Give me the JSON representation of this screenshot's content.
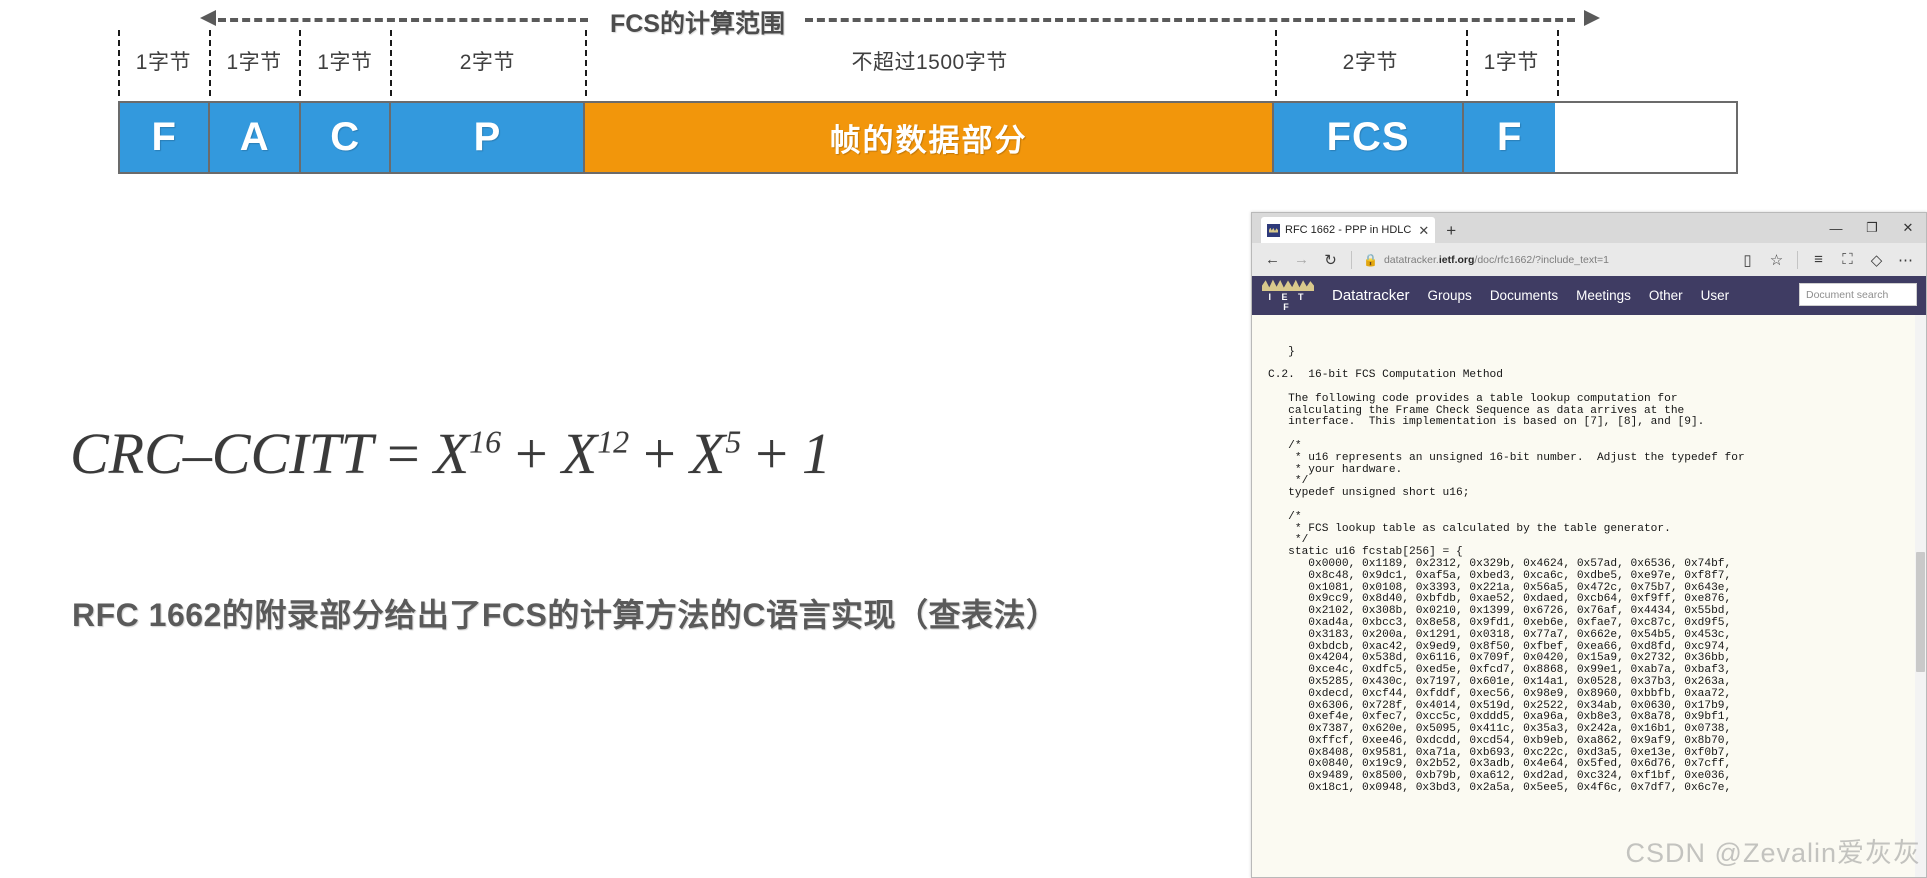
{
  "frame_diagram": {
    "scope_label": "FCS的计算范围",
    "fields": [
      {
        "size_label": "1字节",
        "name": "F",
        "color": "#3399dd",
        "width_pct": 5.6,
        "cjk": false
      },
      {
        "size_label": "1字节",
        "name": "A",
        "color": "#3399dd",
        "width_pct": 5.6,
        "cjk": false
      },
      {
        "size_label": "1字节",
        "name": "C",
        "color": "#3399dd",
        "width_pct": 5.6,
        "cjk": false
      },
      {
        "size_label": "2字节",
        "name": "P",
        "color": "#3399dd",
        "width_pct": 12.0,
        "cjk": false
      },
      {
        "size_label": "不超过1500字节",
        "name": "帧的数据部分",
        "color": "#f2960b",
        "width_pct": 42.6,
        "cjk": true
      },
      {
        "size_label": "2字节",
        "name": "FCS",
        "color": "#3399dd",
        "width_pct": 11.8,
        "cjk": false
      },
      {
        "size_label": "1字节",
        "name": "F",
        "color": "#3399dd",
        "width_pct": 5.6,
        "cjk": false
      }
    ],
    "colors": {
      "blue": "#3399dd",
      "orange": "#f2960b",
      "border": "#6b6b6b",
      "dash": "#1a1a1a"
    }
  },
  "formula": {
    "lhs": "CRC–CCITT",
    "equals": "=",
    "terms": [
      {
        "base": "X",
        "exp": "16"
      },
      {
        "base": "X",
        "exp": "12"
      },
      {
        "base": "X",
        "exp": "5"
      },
      {
        "base": "1",
        "exp": ""
      }
    ],
    "plus": "+"
  },
  "caption": "RFC 1662的附录部分给出了FCS的计算方法的C语言实现（查表法）",
  "browser": {
    "tab": {
      "title": "RFC 1662 - PPP in HDLC",
      "close": "✕"
    },
    "new_tab": "+",
    "window_controls": {
      "minimize": "—",
      "maximize": "❐",
      "close": "✕"
    },
    "toolbar": {
      "back": "←",
      "forward": "→",
      "refresh": "↻",
      "lock": "🔒",
      "url_prefix": "datatracker.",
      "url_bold": "ietf.org",
      "url_suffix": "/doc/rfc1662/?include_text=1",
      "reading_view": "▯",
      "favorite": "☆",
      "reading_list": "≡",
      "collections": "⛶",
      "share": "◇",
      "more": "⋯"
    },
    "ietf_nav": {
      "logo_letters": "I E T F",
      "items": [
        "Datatracker",
        "Groups",
        "Documents",
        "Meetings",
        "Other",
        "User"
      ],
      "search_placeholder": "Document search",
      "bar_color": "#3f3c63"
    },
    "document": {
      "lines": [
        "   }",
        "",
        "C.2.  16-bit FCS Computation Method",
        "",
        "   The following code provides a table lookup computation for",
        "   calculating the Frame Check Sequence as data arrives at the",
        "   interface.  This implementation is based on [7], [8], and [9].",
        "",
        "   /*",
        "    * u16 represents an unsigned 16-bit number.  Adjust the typedef for",
        "    * your hardware.",
        "    */",
        "   typedef unsigned short u16;",
        "",
        "   /*",
        "    * FCS lookup table as calculated by the table generator.",
        "    */",
        "   static u16 fcstab[256] = {",
        "      0x0000, 0x1189, 0x2312, 0x329b, 0x4624, 0x57ad, 0x6536, 0x74bf,",
        "      0x8c48, 0x9dc1, 0xaf5a, 0xbed3, 0xca6c, 0xdbe5, 0xe97e, 0xf8f7,",
        "      0x1081, 0x0108, 0x3393, 0x221a, 0x56a5, 0x472c, 0x75b7, 0x643e,",
        "      0x9cc9, 0x8d40, 0xbfdb, 0xae52, 0xdaed, 0xcb64, 0xf9ff, 0xe876,",
        "      0x2102, 0x308b, 0x0210, 0x1399, 0x6726, 0x76af, 0x4434, 0x55bd,",
        "      0xad4a, 0xbcc3, 0x8e58, 0x9fd1, 0xeb6e, 0xfae7, 0xc87c, 0xd9f5,",
        "      0x3183, 0x200a, 0x1291, 0x0318, 0x77a7, 0x662e, 0x54b5, 0x453c,",
        "      0xbdcb, 0xac42, 0x9ed9, 0x8f50, 0xfbef, 0xea66, 0xd8fd, 0xc974,",
        "      0x4204, 0x538d, 0x6116, 0x709f, 0x0420, 0x15a9, 0x2732, 0x36bb,",
        "      0xce4c, 0xdfc5, 0xed5e, 0xfcd7, 0x8868, 0x99e1, 0xab7a, 0xbaf3,",
        "      0x5285, 0x430c, 0x7197, 0x601e, 0x14a1, 0x0528, 0x37b3, 0x263a,",
        "      0xdecd, 0xcf44, 0xfddf, 0xec56, 0x98e9, 0x8960, 0xbbfb, 0xaa72,",
        "      0x6306, 0x728f, 0x4014, 0x519d, 0x2522, 0x34ab, 0x0630, 0x17b9,",
        "      0xef4e, 0xfec7, 0xcc5c, 0xddd5, 0xa96a, 0xb8e3, 0x8a78, 0x9bf1,",
        "      0x7387, 0x620e, 0x5095, 0x411c, 0x35a3, 0x242a, 0x16b1, 0x0738,",
        "      0xffcf, 0xee46, 0xdcdd, 0xcd54, 0xb9eb, 0xa862, 0x9af9, 0x8b70,",
        "      0x8408, 0x9581, 0xa71a, 0xb693, 0xc22c, 0xd3a5, 0xe13e, 0xf0b7,",
        "      0x0840, 0x19c9, 0x2b52, 0x3adb, 0x4e64, 0x5fed, 0x6d76, 0x7cff,",
        "      0x9489, 0x8500, 0xb79b, 0xa612, 0xd2ad, 0xc324, 0xf1bf, 0xe036,",
        "      0x18c1, 0x0948, 0x3bd3, 0x2a5a, 0x5ee5, 0x4f6c, 0x7df7, 0x6c7e,"
      ]
    }
  },
  "watermark": "CSDN @Zevalin爱灰灰"
}
